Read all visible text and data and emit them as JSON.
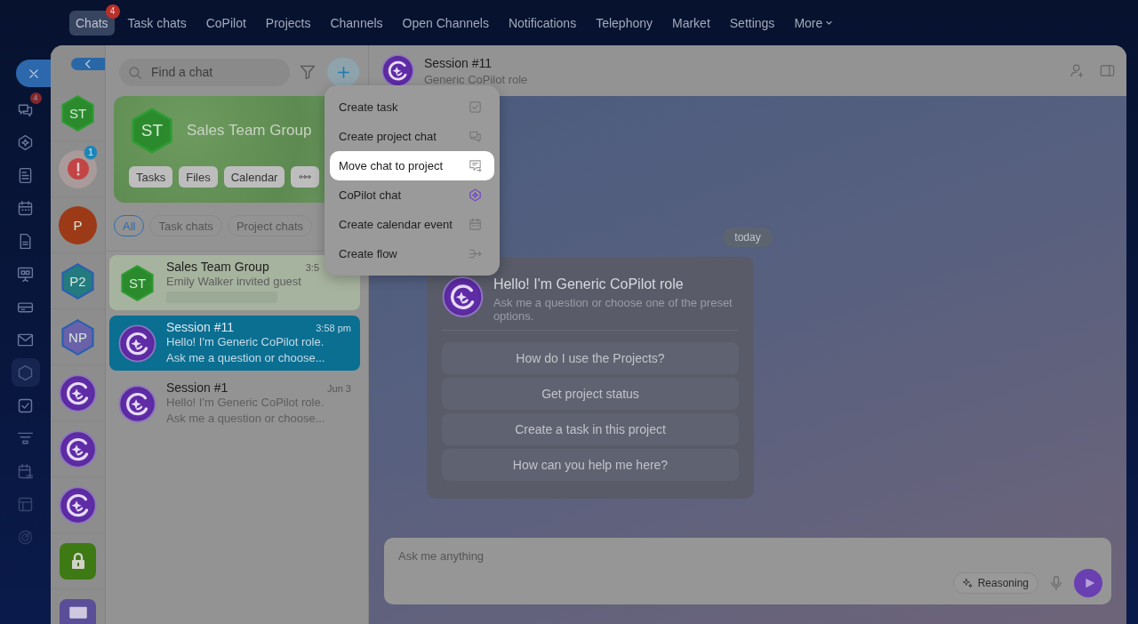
{
  "top_nav": {
    "items": [
      {
        "label": "Chats",
        "selected": true,
        "badge": "4"
      },
      {
        "label": "Task chats",
        "selected": false
      },
      {
        "label": "CoPilot",
        "selected": false
      },
      {
        "label": "Projects",
        "selected": false
      },
      {
        "label": "Channels",
        "selected": false
      },
      {
        "label": "Open Channels",
        "selected": false
      },
      {
        "label": "Notifications",
        "selected": false
      },
      {
        "label": "Telephony",
        "selected": false
      },
      {
        "label": "Market",
        "selected": false
      },
      {
        "label": "Settings",
        "selected": false
      }
    ],
    "more": {
      "label": "More"
    }
  },
  "rail": {
    "items": [
      {
        "kind": "chat",
        "selected": false,
        "badge": "4"
      },
      {
        "kind": "copilot",
        "selected": false
      },
      {
        "kind": "feed",
        "selected": false
      },
      {
        "kind": "calendar",
        "selected": false
      },
      {
        "kind": "document",
        "selected": false
      },
      {
        "kind": "board",
        "selected": false
      },
      {
        "kind": "drive",
        "selected": false
      },
      {
        "kind": "mail",
        "selected": false
      },
      {
        "kind": "hexagon",
        "selected": true
      },
      {
        "kind": "task",
        "selected": false
      },
      {
        "kind": "funnel",
        "selected": false
      },
      {
        "kind": "planner",
        "selected": false
      },
      {
        "kind": "store",
        "selected": false
      },
      {
        "kind": "target",
        "selected": false
      }
    ]
  },
  "avatars": [
    {
      "kind": "hexagon",
      "initials": "ST",
      "color": "#2a8a2c"
    },
    {
      "kind": "alert",
      "badge": "1",
      "color": "#c24444"
    },
    {
      "kind": "circle",
      "initials": "P",
      "color": "#9c3a18"
    },
    {
      "kind": "hexagon",
      "initials": "P2",
      "color": "#237b80"
    },
    {
      "kind": "hexagon",
      "initials": "NP",
      "color": "#6a62a8"
    },
    {
      "kind": "copilot"
    },
    {
      "kind": "copilot"
    },
    {
      "kind": "copilot"
    },
    {
      "kind": "lock",
      "color": "#3e7a14"
    },
    {
      "kind": "square",
      "color": "#5b4e98"
    }
  ],
  "search": {
    "placeholder": "Find a chat"
  },
  "group_card": {
    "initials": "ST",
    "title": "Sales Team Group",
    "chips": [
      "Tasks",
      "Files",
      "Calendar"
    ]
  },
  "chat_filters": [
    {
      "label": "All",
      "selected": true
    },
    {
      "label": "Task chats",
      "selected": false
    },
    {
      "label": "Project chats",
      "selected": false
    }
  ],
  "chats": [
    {
      "avatar": {
        "kind": "hexagon",
        "initials": "ST"
      },
      "title": "Sales Team Group",
      "time": "3:5",
      "preview": [
        "Emily Walker invited guest"
      ],
      "color": "#a6b39e",
      "selected": false
    },
    {
      "avatar": {
        "kind": "copilot"
      },
      "title": "Session #11",
      "time": "3:58 pm",
      "preview": [
        "Hello! I'm Generic CoPilot role.",
        "Ask me a question or choose..."
      ],
      "selected": true
    },
    {
      "avatar": {
        "kind": "copilot"
      },
      "title": "Session #1",
      "time": "Jun 3",
      "preview": [
        "Hello! I'm Generic CoPilot role.",
        "Ask me a question or choose..."
      ],
      "selected": false
    }
  ],
  "conversation": {
    "title": "Session #11",
    "subtitle": "Generic CoPilot role",
    "date": "today",
    "welcome": {
      "title": "Hello! I'm Generic CoPilot role",
      "text": "Ask me a question or choose one of the preset options.",
      "options": [
        "How do I use the Projects?",
        "Get project status",
        "Create a task in this project",
        "How can you help me here?"
      ]
    },
    "composer": {
      "placeholder": "Ask me anything",
      "reasoning": "Reasoning"
    }
  },
  "menu": {
    "items": [
      {
        "label": "Create task",
        "kind": "checkbox",
        "selected": false
      },
      {
        "label": "Create project chat",
        "kind": "chats",
        "selected": false
      },
      {
        "label": "Move chat to project",
        "kind": "move",
        "selected": true
      },
      {
        "label": "CoPilot chat",
        "kind": "copilot",
        "selected": false
      },
      {
        "label": "Create calendar event",
        "kind": "calendar",
        "selected": false
      },
      {
        "label": "Create flow",
        "kind": "flow",
        "selected": false
      }
    ]
  }
}
